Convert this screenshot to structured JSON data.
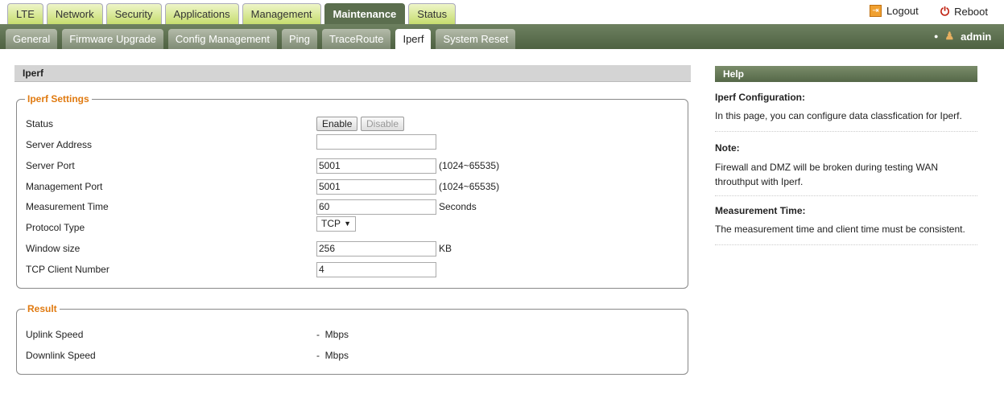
{
  "main_tabs": [
    "LTE",
    "Network",
    "Security",
    "Applications",
    "Management",
    "Maintenance",
    "Status"
  ],
  "active_main_tab": "Maintenance",
  "sub_tabs": [
    "General",
    "Firmware Upgrade",
    "Config Management",
    "Ping",
    "TraceRoute",
    "Iperf",
    "System Reset"
  ],
  "active_sub_tab": "Iperf",
  "header": {
    "logout": "Logout",
    "reboot": "Reboot",
    "user": "admin"
  },
  "section_title": "Iperf",
  "settings": {
    "legend": "Iperf Settings",
    "status_label": "Status",
    "enable": "Enable",
    "disable": "Disable",
    "server_address_label": "Server Address",
    "server_address": "",
    "server_port_label": "Server Port",
    "server_port": "5001",
    "port_range": "(1024~65535)",
    "management_port_label": "Management Port",
    "management_port": "5001",
    "measurement_time_label": "Measurement Time",
    "measurement_time": "60",
    "seconds": "Seconds",
    "protocol_label": "Protocol Type",
    "protocol": "TCP",
    "window_size_label": "Window size",
    "window_size": "256",
    "kb": "KB",
    "client_number_label": "TCP Client Number",
    "client_number": "4"
  },
  "result": {
    "legend": "Result",
    "uplink_label": "Uplink Speed",
    "uplink": "-  Mbps",
    "downlink_label": "Downlink Speed",
    "downlink": "-  Mbps"
  },
  "help": {
    "title": "Help",
    "h1": "Iperf Configuration:",
    "p1": "In this page, you can configure data classfication for Iperf.",
    "h2": "Note:",
    "p2": "Firewall and DMZ will be broken during testing WAN throuthput with Iperf.",
    "h3": "Measurement Time:",
    "p3": "The measurement time and client time must be consistent."
  }
}
